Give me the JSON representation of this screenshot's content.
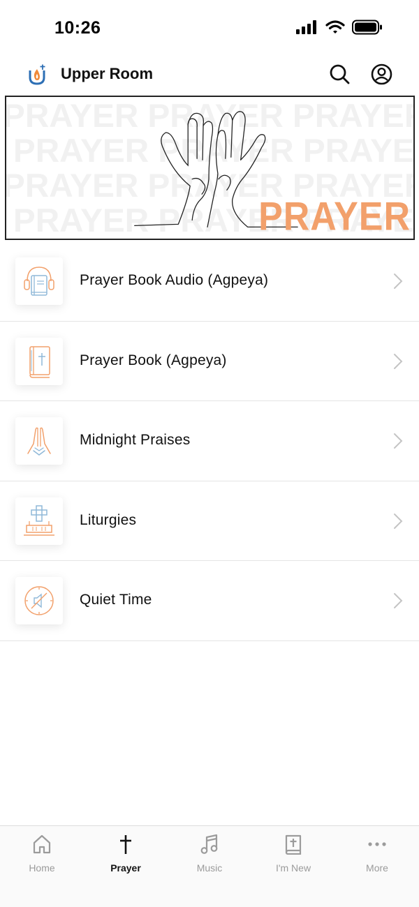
{
  "status_bar": {
    "time": "10:26"
  },
  "header": {
    "title": "Upper Room"
  },
  "banner": {
    "word": "PRAYER",
    "word_color": "#f2a06b"
  },
  "menu": [
    {
      "label": "Prayer Book Audio (Agpeya)",
      "icon": "audio-book-icon"
    },
    {
      "label": "Prayer Book (Agpeya)",
      "icon": "prayer-book-icon"
    },
    {
      "label": "Midnight Praises",
      "icon": "praying-hands-icon"
    },
    {
      "label": "Liturgies",
      "icon": "altar-cross-icon"
    },
    {
      "label": "Quiet Time",
      "icon": "quiet-clock-icon"
    }
  ],
  "tabs": [
    {
      "label": "Home",
      "icon": "home-icon",
      "active": false
    },
    {
      "label": "Prayer",
      "icon": "cross-icon",
      "active": true
    },
    {
      "label": "Music",
      "icon": "music-note-icon",
      "active": false
    },
    {
      "label": "I'm New",
      "icon": "bible-icon",
      "active": false
    },
    {
      "label": "More",
      "icon": "more-dots-icon",
      "active": false
    }
  ],
  "colors": {
    "accent": "#f2a06b",
    "icon_blue": "#8fb8d8",
    "inactive": "#9b9b9b"
  }
}
